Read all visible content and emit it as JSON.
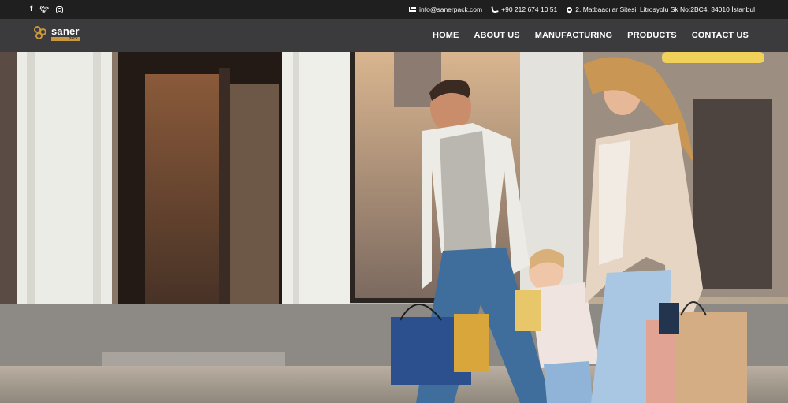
{
  "topbar": {
    "social": [
      {
        "icon": "facebook-icon",
        "glyph": "f"
      },
      {
        "icon": "twitter-icon",
        "glyph": "🐦"
      },
      {
        "icon": "instagram-icon",
        "glyph": ""
      }
    ],
    "email": "info@sanerpack.com",
    "phone": "+90 212 674 10 51",
    "address": "2. Matbaacılar Sitesi, Litrosyolu Sk No:2BC4, 34010 İstanbul"
  },
  "nav": {
    "logo_word": "saner",
    "logo_sub": "pack",
    "items": [
      "HOME",
      "ABOUT US",
      "MANUFACTURING",
      "PRODUCTS",
      "CONTACT US"
    ]
  },
  "colors": {
    "topbar_bg": "#1f1f1f",
    "nav_bg": "#3b3b3d",
    "brand_gold": "#c9973f"
  },
  "hero": {
    "image": "hero-family-shopping-image"
  }
}
